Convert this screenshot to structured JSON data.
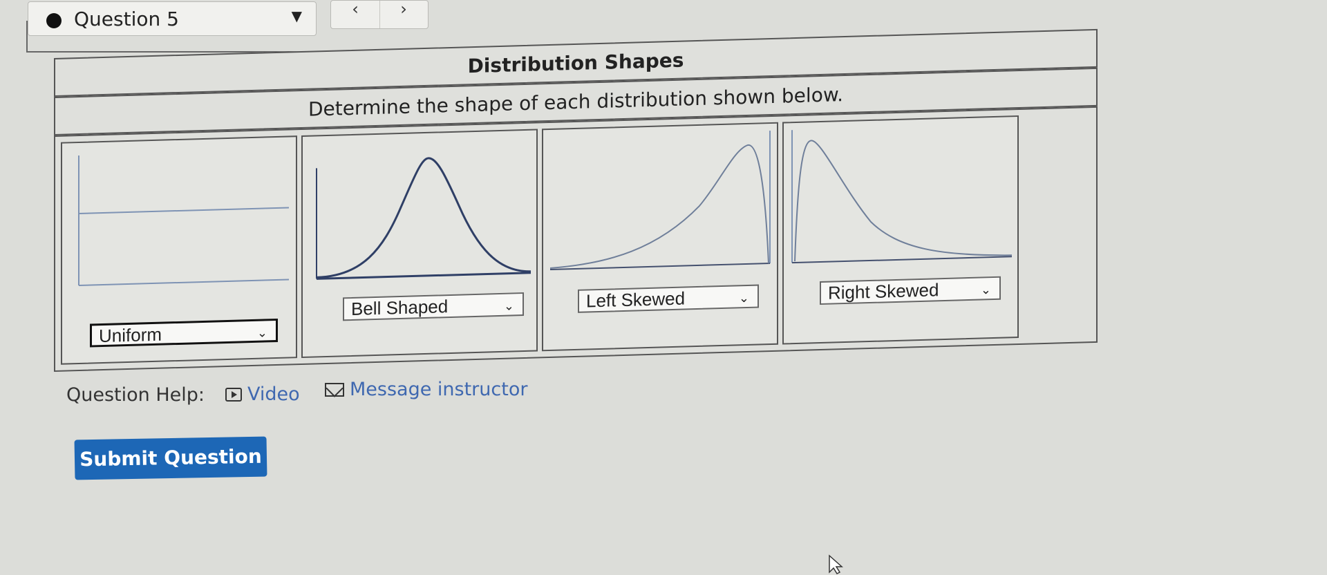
{
  "question": {
    "label": "Question 5"
  },
  "problem": {
    "title": "Distribution Shapes",
    "instruction": "Determine the shape of each distribution shown below."
  },
  "cells": [
    {
      "selected": "Uniform",
      "graph": "uniform"
    },
    {
      "selected": "Bell Shaped",
      "graph": "bell"
    },
    {
      "selected": "Left Skewed",
      "graph": "left-skew"
    },
    {
      "selected": "Right Skewed",
      "graph": "right-skew"
    }
  ],
  "help": {
    "label": "Question Help:",
    "video": "Video",
    "message": "Message instructor"
  },
  "submit": {
    "label": "Submit Question"
  },
  "colors": {
    "accent": "#1d67b6",
    "link": "#3f68b0",
    "curve": "#2f3f66"
  }
}
